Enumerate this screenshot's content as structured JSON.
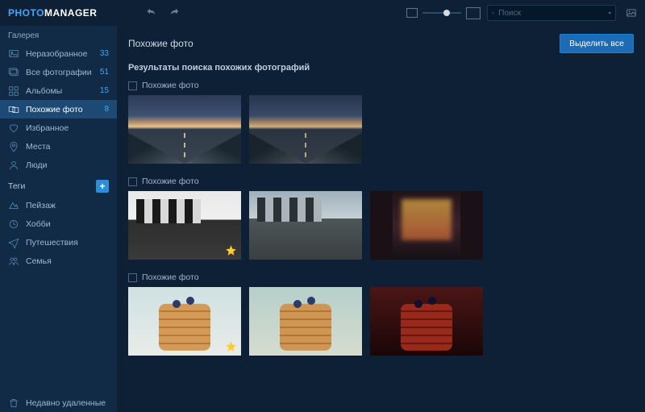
{
  "logo": {
    "part1": "PHOTO",
    "part2": "MANAGER"
  },
  "search": {
    "placeholder": "Поиск"
  },
  "sidebar": {
    "gallery_title": "Галерея",
    "items": [
      {
        "label": "Неразобранное",
        "count": "33"
      },
      {
        "label": "Все фотографии",
        "count": "51"
      },
      {
        "label": "Альбомы",
        "count": "15"
      },
      {
        "label": "Похожие фото",
        "count": "8"
      },
      {
        "label": "Избранное",
        "count": ""
      },
      {
        "label": "Места",
        "count": ""
      },
      {
        "label": "Люди",
        "count": ""
      }
    ],
    "tags_title": "Теги",
    "tags": [
      {
        "label": "Пейзаж"
      },
      {
        "label": "Хобби"
      },
      {
        "label": "Путешествия"
      },
      {
        "label": "Семья"
      }
    ],
    "trash_label": "Недавно удаленные"
  },
  "main": {
    "title": "Похожие фото",
    "select_all": "Выделить все",
    "results_heading": "Результаты поиска похожих фотографий",
    "groups": [
      {
        "label": "Похожие фото"
      },
      {
        "label": "Похожие фото"
      },
      {
        "label": "Похожие фото"
      }
    ]
  }
}
